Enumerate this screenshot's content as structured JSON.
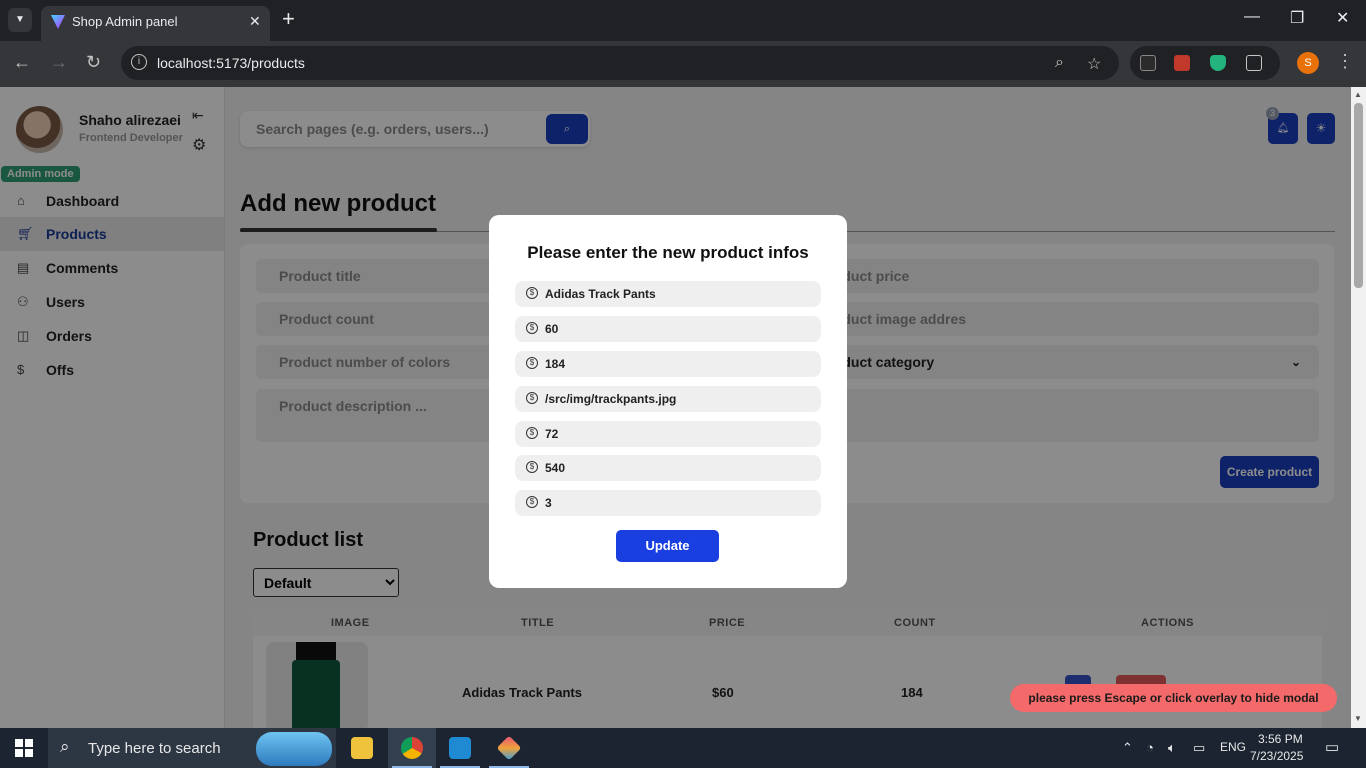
{
  "browser": {
    "tab_title": "Shop Admin panel",
    "url": "localhost:5173/products",
    "profile_initial": "S"
  },
  "sidebar": {
    "user_name": "Shaho alirezaei",
    "user_role": "Frontend Developer",
    "admin_badge": "Admin mode",
    "items": [
      {
        "label": "Dashboard",
        "icon": "home-icon"
      },
      {
        "label": "Products",
        "icon": "cart-icon",
        "active": true
      },
      {
        "label": "Comments",
        "icon": "comment-icon"
      },
      {
        "label": "Users",
        "icon": "users-icon"
      },
      {
        "label": "Orders",
        "icon": "bag-icon"
      },
      {
        "label": "Offs",
        "icon": "dollar-icon"
      }
    ]
  },
  "header": {
    "search_placeholder": "Search pages (e.g. orders, users...)",
    "notification_count": "3"
  },
  "add_product": {
    "heading": "Add new product",
    "fields": {
      "title": "Product title",
      "price": "Product price",
      "count": "Product count",
      "image": "Product image addres",
      "colors": "Product number of colors",
      "category": "Product category",
      "description": "Product description ..."
    },
    "create_label": "Create product"
  },
  "product_list": {
    "heading": "Product list",
    "sort_value": "Default",
    "columns": [
      "IMAGE",
      "TITLE",
      "PRICE",
      "COUNT",
      "ACTIONS"
    ],
    "rows": [
      {
        "title": "Adidas Track Pants",
        "price": "$60",
        "count": "184"
      }
    ]
  },
  "modal": {
    "title": "Please enter the new product infos",
    "inputs": [
      "Adidas Track Pants",
      "60",
      "184",
      "/src/img/trackpants.jpg",
      "72",
      "540",
      "3"
    ],
    "update_label": "Update"
  },
  "toast": "please press Escape or click overlay to hide modal",
  "taskbar": {
    "search_text": "Type here to search",
    "language": "ENG",
    "time": "3:56 PM",
    "date": "7/23/2025"
  }
}
